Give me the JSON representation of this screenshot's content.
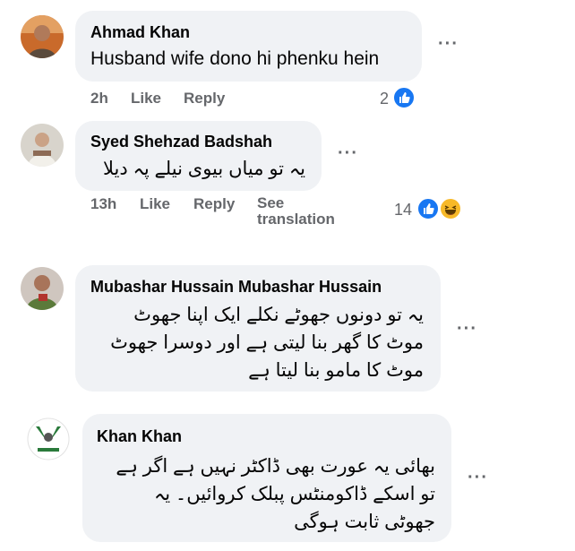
{
  "comments": [
    {
      "author": "Ahmad Khan",
      "text_lines": [
        "Husband wife dono hi phenku hein"
      ],
      "time": "2h",
      "like_label": "Like",
      "reply_label": "Reply",
      "reaction_count": "2",
      "reactions": [
        "like-icon"
      ]
    },
    {
      "author": "Syed Shehzad Badshah",
      "text_lines": [
        "یہ تو میاں بیوی نیلے پہ دیلا"
      ],
      "time": "13h",
      "like_label": "Like",
      "reply_label": "Reply",
      "see_translation_lines": [
        "See",
        "translation"
      ],
      "reaction_count": "14",
      "reactions": [
        "like-icon",
        "haha-icon"
      ]
    },
    {
      "author": "Mubashar Hussain Mubashar Hussain",
      "text_lines": [
        "یہ تو دونوں جھوٹے نکلے ایک اپنا جھوٹ",
        "موٹ کا گھر بنا لیتی ہے اور دوسرا جھوٹ",
        "موٹ کا مامو بنا لیتا ہے"
      ]
    },
    {
      "author": "Khan Khan",
      "text_lines": [
        "بھائی یہ عورت بھی ڈاکٹر نہیں ہے اگر ہے",
        "تو اسکے ڈاکومنٹس پبلک کروائیں۔ یہ",
        "جھوٹی ثابت ہوگی"
      ]
    }
  ],
  "more_options_label": "···",
  "colors": {
    "bubble": "#f0f2f5",
    "meta_text": "#65676b",
    "like_blue": "#1877f2",
    "haha_yellow": "#f7b928"
  }
}
